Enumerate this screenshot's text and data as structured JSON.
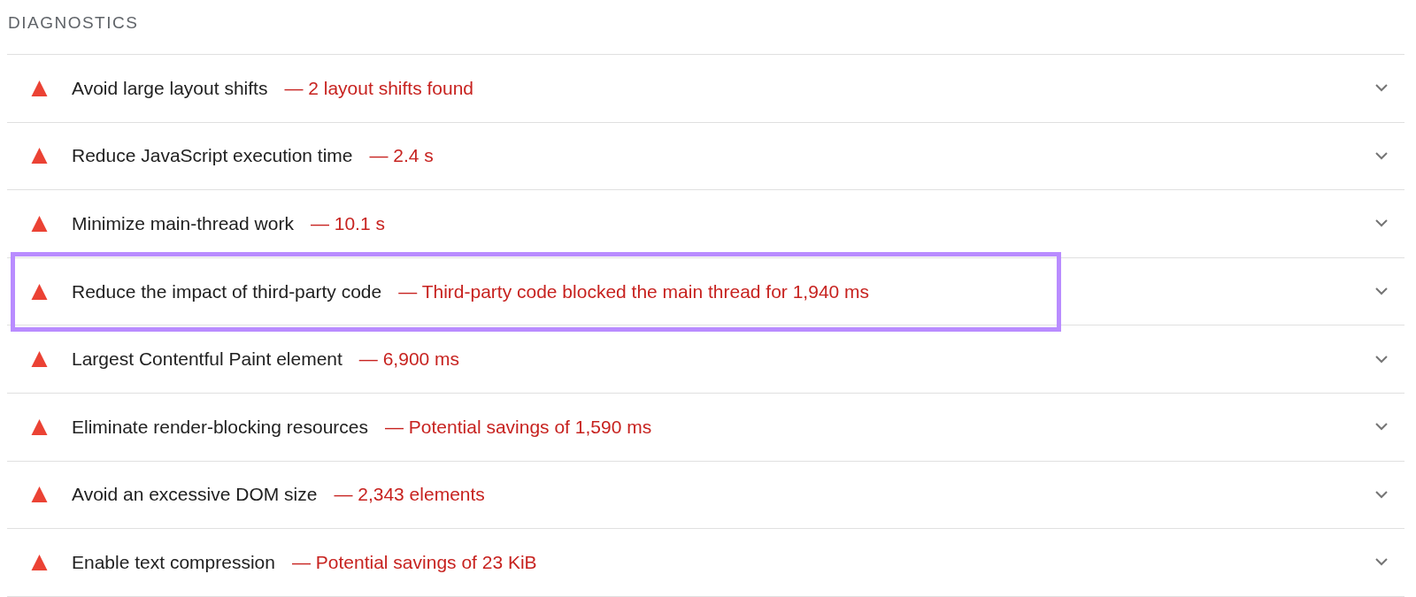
{
  "section_title": "DIAGNOSTICS",
  "audits": [
    {
      "title": "Avoid large layout shifts",
      "detail": "— 2 layout shifts found",
      "highlighted": false
    },
    {
      "title": "Reduce JavaScript execution time",
      "detail": "— 2.4 s",
      "highlighted": false
    },
    {
      "title": "Minimize main-thread work",
      "detail": "— 10.1 s",
      "highlighted": false
    },
    {
      "title": "Reduce the impact of third-party code",
      "detail": "— Third-party code blocked the main thread for 1,940 ms",
      "highlighted": true
    },
    {
      "title": "Largest Contentful Paint element",
      "detail": "— 6,900 ms",
      "highlighted": false
    },
    {
      "title": "Eliminate render-blocking resources",
      "detail": "— Potential savings of 1,590 ms",
      "highlighted": false
    },
    {
      "title": "Avoid an excessive DOM size",
      "detail": "— 2,343 elements",
      "highlighted": false
    },
    {
      "title": "Enable text compression",
      "detail": "— Potential savings of 23 KiB",
      "highlighted": false
    }
  ]
}
